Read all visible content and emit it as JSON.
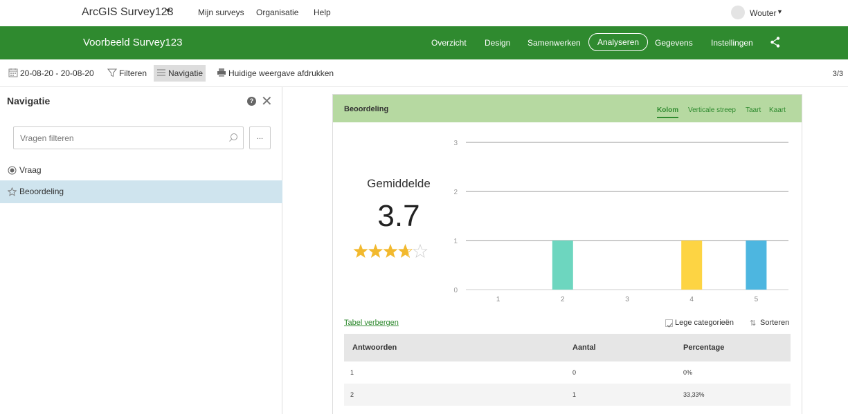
{
  "topbar": {
    "brand": "ArcGIS Survey123",
    "nav": [
      "Mijn surveys",
      "Organisatie",
      "Help"
    ],
    "user": "Wouter"
  },
  "header": {
    "survey_title": "Voorbeeld Survey123",
    "nav": [
      "Overzicht",
      "Design",
      "Samenwerken",
      "Analyseren",
      "Gegevens",
      "Instellingen"
    ],
    "active_nav": "Analyseren",
    "color": "#2f8a2f"
  },
  "toolbar": {
    "date_range": "20-08-20 - 20-08-20",
    "filter_label": "Filteren",
    "nav_label": "Navigatie",
    "print_label": "Huidige weergave afdrukken",
    "pager": "3/3"
  },
  "sidebar": {
    "title": "Navigatie",
    "search_placeholder": "Vragen filteren",
    "more_label": "...",
    "items": [
      {
        "label": "Vraag",
        "icon": "radio-icon",
        "selected": false
      },
      {
        "label": "Beoordeling",
        "icon": "star-outline-icon",
        "selected": true
      }
    ],
    "selected_color": "#cfe4ee"
  },
  "card": {
    "title": "Beoordeling",
    "tabs": [
      "Kolom",
      "Verticale streep",
      "Taart",
      "Kaart"
    ],
    "active_tab": "Kolom",
    "average_label": "Gemiddelde",
    "average_value": "3.7",
    "rating": 3.7,
    "rating_max": 5,
    "table_toggle": "Tabel verbergen",
    "empty_categories_label": "Lege categorieën",
    "empty_categories_checked": true,
    "sort_label": "Sorteren",
    "table": {
      "headers": [
        "Antwoorden",
        "Aantal",
        "Percentage"
      ],
      "rows": [
        [
          "1",
          "0",
          "0%"
        ],
        [
          "2",
          "1",
          "33,33%"
        ]
      ]
    }
  },
  "chart_data": {
    "type": "bar",
    "categories": [
      "1",
      "2",
      "3",
      "4",
      "5"
    ],
    "values": [
      0,
      1,
      0,
      1,
      1
    ],
    "colors": [
      "#8fd3c0",
      "#6dd6bf",
      "#f2c94c",
      "#fdd443",
      "#4db6e0"
    ],
    "ylim": [
      0,
      3
    ],
    "yticks": [
      "0",
      "1",
      "2",
      "3"
    ],
    "grid": true
  }
}
